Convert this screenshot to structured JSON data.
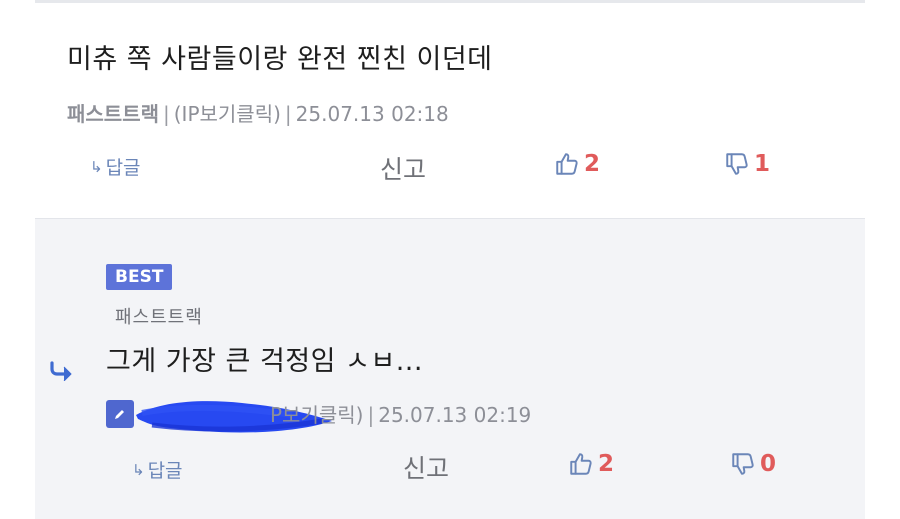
{
  "comments": [
    {
      "text": "미츄 쪽 사람들이랑 완전 찐친 이던데",
      "nickname": "패스트트랙",
      "ip_label": "(IP보기클릭)",
      "date": "25.07.13 02:18",
      "reply_label": "답글",
      "report_label": "신고",
      "likes": "2",
      "dislikes": "1"
    },
    {
      "badge": "BEST",
      "reply_to": "패스트트랙",
      "text": "그게 가장 큰 걱정임 ㅅㅂ...",
      "ip_label_partial": "P보기클릭)",
      "date": "25.07.13 02:19",
      "reply_label": "답글",
      "report_label": "신고",
      "likes": "2",
      "dislikes": "0"
    }
  ],
  "colors": {
    "accent": "#5d73d9",
    "vote_count": "#e05b5b",
    "thumb_icon": "#6b86b8",
    "scribble": "#1b3ff0"
  },
  "icons": [
    "reply-arrow-icon",
    "thumbs-up-icon",
    "thumbs-down-icon",
    "edit-pencil-icon"
  ]
}
